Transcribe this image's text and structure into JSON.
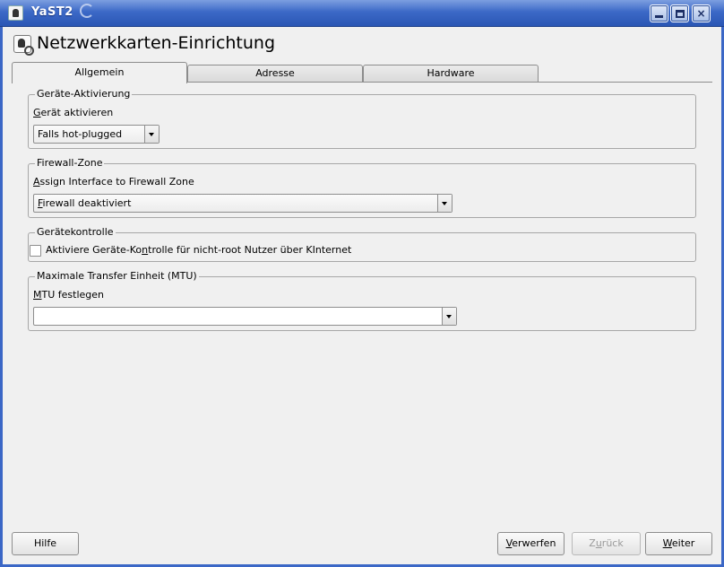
{
  "window": {
    "title": "YaST2",
    "minimize_label": "",
    "maximize_label": "",
    "close_label": "×"
  },
  "page": {
    "title": "Netzwerkkarten-Einrichtung"
  },
  "tabs": [
    {
      "label": "Allgemein",
      "active": true
    },
    {
      "label": "Adresse",
      "active": false
    },
    {
      "label": "Hardware",
      "active": false
    }
  ],
  "activation": {
    "group_title": "Geräte-Aktivierung",
    "label_underlined": "G",
    "label_rest": "erät aktivieren",
    "value": "Falls hot-plugged"
  },
  "firewall": {
    "group_title": "Firewall-Zone",
    "label_underlined": "A",
    "label_rest": "ssign Interface to Firewall Zone",
    "value_underlined": "F",
    "value_rest": "irewall deaktiviert"
  },
  "device_control": {
    "group_title": "Gerätekontrolle",
    "checkbox_label_before": "Aktiviere Geräte-Ko",
    "checkbox_label_underlined": "n",
    "checkbox_label_after": "trolle für nicht-root Nutzer über KInternet",
    "checked": false
  },
  "mtu": {
    "group_title": "Maximale Transfer Einheit (MTU)",
    "label_underlined": "M",
    "label_rest": "TU festlegen",
    "value": ""
  },
  "buttons": {
    "help": "Hilfe",
    "discard_underlined": "V",
    "discard_rest": "erwerfen",
    "back_before": "Z",
    "back_underlined": "u",
    "back_after": "rück",
    "next_underlined": "W",
    "next_rest": "eiter"
  },
  "colors": {
    "titlebar": "#3c69c7",
    "background": "#f0f0f0",
    "disabled_text": "#9a9a9a"
  }
}
